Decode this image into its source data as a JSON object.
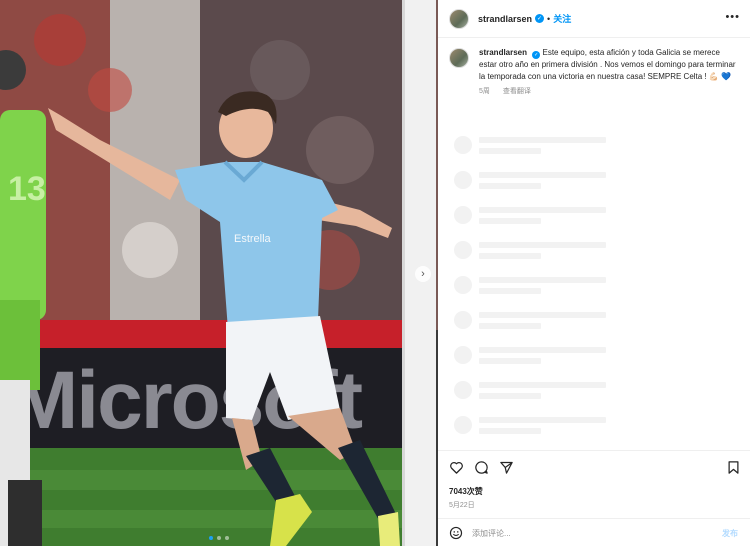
{
  "post": {
    "photo_alt_name": "football-player-photo",
    "carousel": {
      "count": 3,
      "active_index": 1
    }
  },
  "header": {
    "username": "strandlarsen",
    "separator": "•",
    "follow_label": "关注",
    "more_icon": "more-horizontal-icon"
  },
  "caption": {
    "username": "strandlarsen",
    "text": "Este equipo, esta afición y toda Galicia se merece estar otro año en primera división . Nos vemos el domingo para terminar la temporada con una victoria en nuestra casa! SEMPRE Celta ! 💪🏻 💙",
    "age": "5周",
    "translate_label": "查看翻译"
  },
  "comments": {
    "loading_placeholders": 9
  },
  "actions": {
    "like_icon": "heart-icon",
    "comment_icon": "comment-icon",
    "share_icon": "share-icon",
    "save_icon": "bookmark-icon"
  },
  "likes": "7043次赞",
  "date": "5月22日",
  "comment_box": {
    "placeholder": "添加评论...",
    "post_label": "发布",
    "emoji_icon": "emoji-icon"
  },
  "colors": {
    "accent": "#0095f6",
    "jersey": "#8ec6ea",
    "keeper": "#7fd34b",
    "skeleton": "#f2f2f2"
  }
}
